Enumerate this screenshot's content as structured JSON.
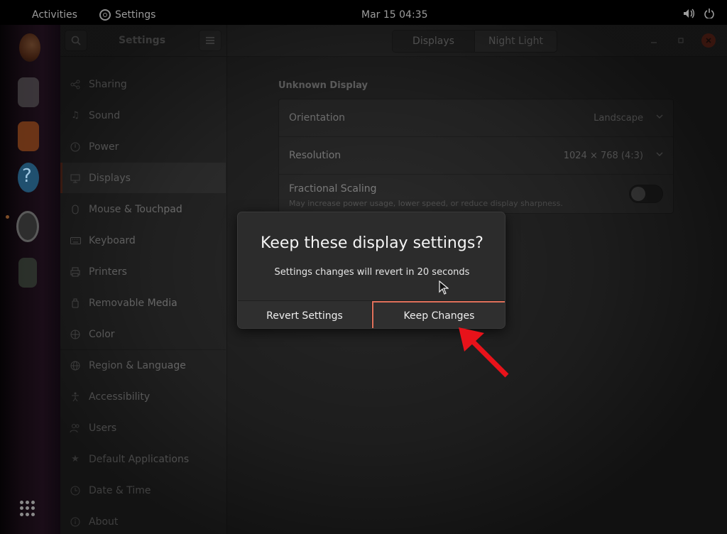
{
  "topbar": {
    "activities": "Activities",
    "app_name": "Settings",
    "clock": "Mar 15  04:35"
  },
  "window": {
    "title": "Settings",
    "tabs": [
      {
        "label": "Displays",
        "selected": true
      },
      {
        "label": "Night Light",
        "selected": false
      }
    ]
  },
  "sidebar": {
    "selected": "Displays",
    "items": [
      {
        "label": "Sharing",
        "icon": "share-icon"
      },
      {
        "label": "Sound",
        "icon": "music-note-icon"
      },
      {
        "label": "Power",
        "icon": "power-icon"
      },
      {
        "label": "Displays",
        "icon": "monitor-icon"
      },
      {
        "label": "Mouse & Touchpad",
        "icon": "mouse-icon"
      },
      {
        "label": "Keyboard",
        "icon": "keyboard-icon"
      },
      {
        "label": "Printers",
        "icon": "printer-icon"
      },
      {
        "label": "Removable Media",
        "icon": "usb-drive-icon"
      },
      {
        "label": "Color",
        "icon": "color-icon"
      },
      {
        "label": "Region & Language",
        "icon": "globe-icon"
      },
      {
        "label": "Accessibility",
        "icon": "accessibility-icon"
      },
      {
        "label": "Users",
        "icon": "users-icon"
      },
      {
        "label": "Default Applications",
        "icon": "star-icon"
      },
      {
        "label": "Date & Time",
        "icon": "clock-icon"
      },
      {
        "label": "About",
        "icon": "info-icon"
      }
    ]
  },
  "content": {
    "display_name": "Unknown Display",
    "orientation": {
      "label": "Orientation",
      "value": "Landscape"
    },
    "resolution": {
      "label": "Resolution",
      "value": "1024 × 768 (4:3)"
    },
    "fractional_scaling": {
      "label": "Fractional Scaling",
      "description": "May increase power usage, lower speed, or reduce display sharpness.",
      "enabled": false
    }
  },
  "dialog": {
    "heading": "Keep these display settings?",
    "message": "Settings changes will revert in 20 seconds",
    "revert_label": "Revert Settings",
    "keep_label": "Keep Changes"
  },
  "colors": {
    "highlight_border": "#e0705a",
    "annotation_arrow": "#e8121a",
    "close_button": "#7a2f20"
  }
}
